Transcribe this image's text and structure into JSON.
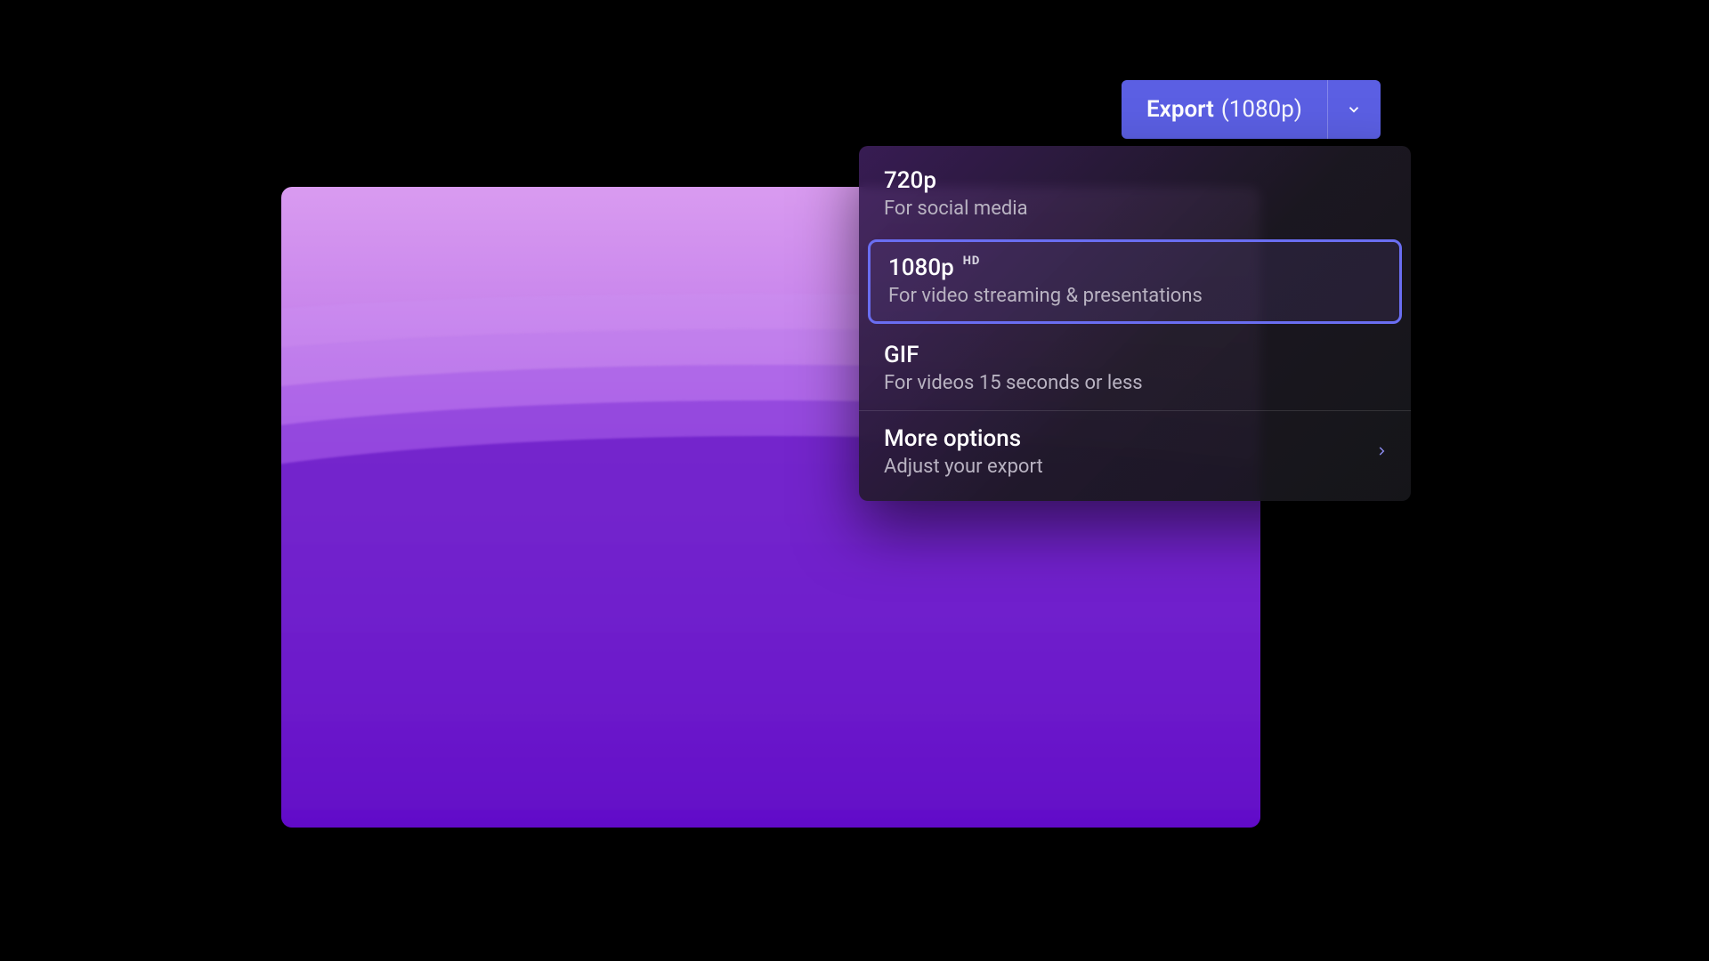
{
  "export_button": {
    "label": "Export",
    "suffix": "(1080p)"
  },
  "dropdown": {
    "options": [
      {
        "title": "720p",
        "subtitle": "For social media",
        "badge": ""
      },
      {
        "title": "1080p",
        "subtitle": "For video streaming & presentations",
        "badge": "HD",
        "selected": true
      },
      {
        "title": "GIF",
        "subtitle": "For videos 15 seconds or less",
        "badge": ""
      }
    ],
    "more": {
      "title": "More options",
      "subtitle": "Adjust your export"
    }
  }
}
